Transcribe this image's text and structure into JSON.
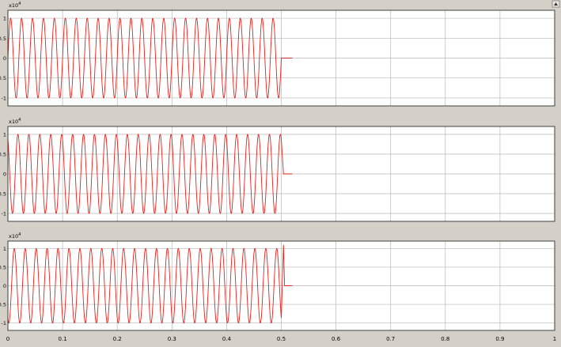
{
  "window": {
    "background": "#d4d0c8",
    "plot_background": "#ffffff",
    "trace_color": "#e8201a",
    "grid_color": "#b8b8b8",
    "corner_icon": "restore-axes-icon"
  },
  "chart_data": [
    {
      "type": "line",
      "title": "",
      "xlabel": "",
      "ylabel": "",
      "xlim": [
        0,
        1
      ],
      "ylim": [
        -12000,
        12000
      ],
      "exponent_label": "x10",
      "exponent_sup": "4",
      "grid": true,
      "x_ticks": [
        "0",
        "0.1",
        "0.2",
        "0.3",
        "0.4",
        "0.5",
        "0.6",
        "0.7",
        "0.8",
        "0.9",
        "1"
      ],
      "y_ticks": [
        "-1",
        "-0.5",
        "0",
        "0.5",
        "1"
      ],
      "show_x_tick_labels": false,
      "series": [
        {
          "amplitude": 10000,
          "frequency_hz": 50,
          "phase_deg": 0,
          "t_start": 0,
          "t_end": 0.5,
          "hold_until": 0.52,
          "end_spike": 0
        }
      ]
    },
    {
      "type": "line",
      "title": "",
      "xlabel": "",
      "ylabel": "",
      "xlim": [
        0,
        1
      ],
      "ylim": [
        -12000,
        12000
      ],
      "exponent_label": "x10",
      "exponent_sup": "4",
      "grid": true,
      "x_ticks": [
        "0",
        "0.1",
        "0.2",
        "0.3",
        "0.4",
        "0.5",
        "0.6",
        "0.7",
        "0.8",
        "0.9",
        "1"
      ],
      "y_ticks": [
        "-1",
        "-0.5",
        "0",
        "0.5",
        "1"
      ],
      "show_x_tick_labels": false,
      "series": [
        {
          "amplitude": 10000,
          "frequency_hz": 50,
          "phase_deg": 120,
          "t_start": 0,
          "t_end": 0.5,
          "hold_until": 0.52,
          "end_spike": 0
        }
      ]
    },
    {
      "type": "line",
      "title": "",
      "xlabel": "",
      "ylabel": "",
      "xlim": [
        0,
        1
      ],
      "ylim": [
        -12000,
        12000
      ],
      "exponent_label": "x10",
      "exponent_sup": "4",
      "grid": true,
      "x_ticks": [
        "0",
        "0.1",
        "0.2",
        "0.3",
        "0.4",
        "0.5",
        "0.6",
        "0.7",
        "0.8",
        "0.9",
        "1"
      ],
      "y_ticks": [
        "-1",
        "-0.5",
        "0",
        "0.5",
        "1"
      ],
      "show_x_tick_labels": true,
      "series": [
        {
          "amplitude": 10000,
          "frequency_hz": 50,
          "phase_deg": 240,
          "t_start": 0,
          "t_end": 0.5,
          "hold_until": 0.52,
          "end_spike": 11000
        }
      ]
    }
  ]
}
